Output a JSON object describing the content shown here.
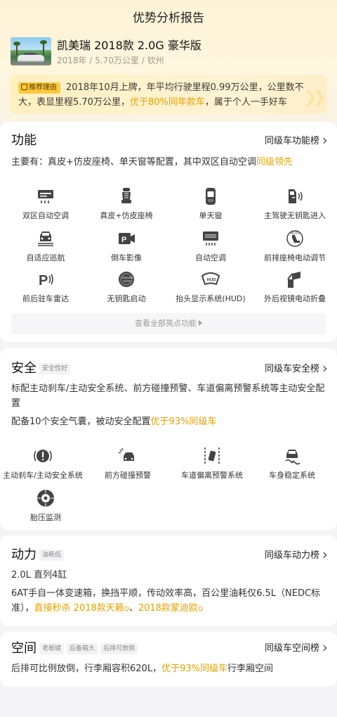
{
  "header": {
    "title": "优势分析报告"
  },
  "car": {
    "name": "凯美瑞 2018款 2.0G 豪华版",
    "meta": "2018年 / 5.70万公里 / 钦州"
  },
  "reason": {
    "badge": "推荐理由",
    "text_a": "2018年10月上牌，年平均行驶里程0.99万公里，公里数不大，表显里程5.70万公里，",
    "text_hl": "优于80%同年款车",
    "text_b": "，属于个人一手好车"
  },
  "function": {
    "title": "功能",
    "link": "同级车功能榜",
    "desc_a": "主要有：真皮+仿皮座椅、单天窗等配置，其中双区自动空调",
    "desc_hl": "同级领先",
    "features": [
      {
        "label": "双区自动空调",
        "icon": "dual-zone-ac-icon"
      },
      {
        "label": "真皮+仿皮座椅",
        "icon": "leather-seat-icon"
      },
      {
        "label": "单天窗",
        "icon": "sunroof-icon"
      },
      {
        "label": "主驾驶无钥匙进入",
        "icon": "keyless-entry-icon"
      },
      {
        "label": "自适应巡航",
        "icon": "adaptive-cruise-icon"
      },
      {
        "label": "倒车影像",
        "icon": "reverse-camera-icon"
      },
      {
        "label": "自动空调",
        "icon": "auto-ac-icon"
      },
      {
        "label": "前排座椅电动调节",
        "icon": "power-seat-icon"
      },
      {
        "label": "前后驻车雷达",
        "icon": "parking-radar-icon"
      },
      {
        "label": "无钥匙启动",
        "icon": "keyless-start-icon"
      },
      {
        "label": "抬头显示系统(HUD)",
        "icon": "hud-icon"
      },
      {
        "label": "外后视镜电动折叠",
        "icon": "mirror-fold-icon"
      }
    ],
    "more": "查看全部亮点功能"
  },
  "safety": {
    "title": "安全",
    "tag": "安全性好",
    "link": "同级车安全榜",
    "desc1": "标配主动刹车/主动安全系统、前方碰撞预警、车道偏离预警系统等主动安全配置",
    "desc2_a": "配备10个安全气囊，被动安全配置",
    "desc2_hl": "优于93%同级车",
    "features": [
      {
        "label": "主动刹车/主动安全系统",
        "icon": "active-brake-icon"
      },
      {
        "label": "前方碰撞预警",
        "icon": "collision-warning-icon"
      },
      {
        "label": "车道偏离预警系统",
        "icon": "lane-departure-icon"
      },
      {
        "label": "车身稳定系统",
        "icon": "stability-control-icon"
      },
      {
        "label": "胎压监测",
        "icon": "tire-pressure-icon"
      }
    ]
  },
  "power": {
    "title": "动力",
    "tag": "油耗低",
    "link": "同级车动力榜",
    "engine": "2.0L 直列4缸",
    "desc_a": "6AT手自一体变速箱，换挡平顺，传动效率高，百公里油耗仅6.5L（NEDC标准），",
    "desc_hl1": "直接秒杀 2018款天籁",
    "sep": "、",
    "desc_hl2": "2018款蒙迪欧"
  },
  "space": {
    "title": "空间",
    "tags": [
      "老板键",
      "后备箱大",
      "后排可放倒"
    ],
    "link": "同级车空间榜",
    "desc_a": "后排可比例放倒，行李厢容积620L，",
    "desc_hl": "优于93%同级车",
    "desc_b": "行李厢空间"
  },
  "colors": {
    "accent": "#e5a100",
    "badge": "#ffc93c",
    "hero_bg": "#fdf3d6"
  }
}
